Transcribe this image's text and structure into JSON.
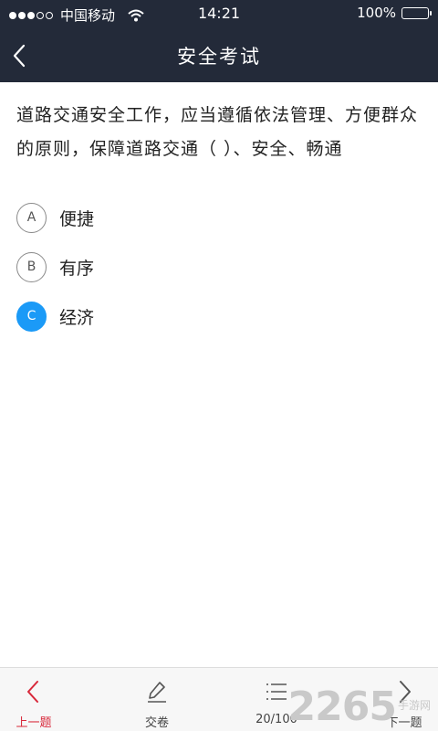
{
  "status_bar": {
    "carrier": "中国移动",
    "time": "14:21",
    "battery": "100%",
    "battery_level": 1.0
  },
  "nav": {
    "title": "安全考试",
    "back_icon": "chevron-left-icon"
  },
  "question": {
    "text": "道路交通安全工作，应当遵循依法管理、方便群众的原则，保障道路交通（ ）、安全、畅通"
  },
  "options": [
    {
      "letter": "A",
      "text": "便捷",
      "selected": false
    },
    {
      "letter": "B",
      "text": "有序",
      "selected": false
    },
    {
      "letter": "C",
      "text": "经济",
      "selected": true
    }
  ],
  "tab_bar": {
    "prev_label": "上一题",
    "submit_label": "交卷",
    "progress_label": "20/100",
    "next_label": "下一题"
  },
  "colors": {
    "header_bg": "#232a39",
    "selected_blue": "#1b9af7",
    "active_red": "#d8283a"
  },
  "watermark": {
    "number": "2265",
    "text": "手游网"
  }
}
